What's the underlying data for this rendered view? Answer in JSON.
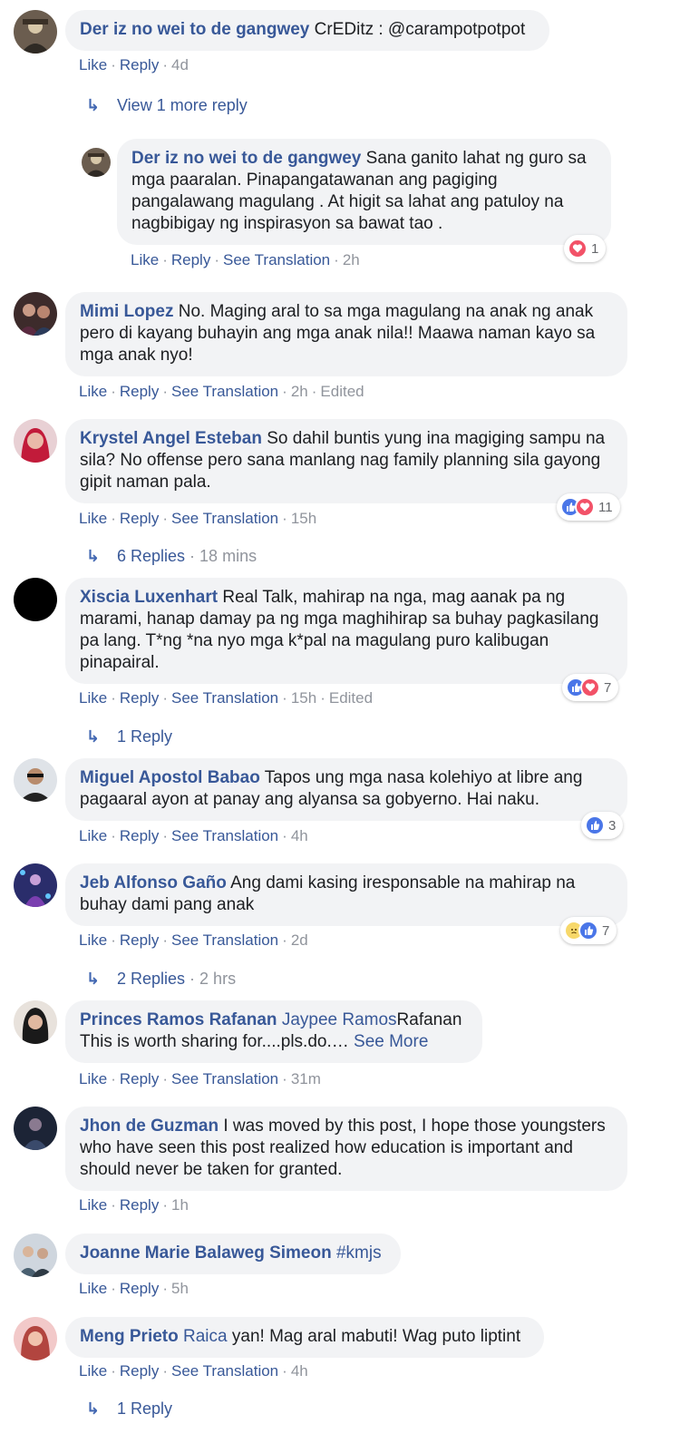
{
  "colors": {
    "link": "#385898",
    "meta": "#90949c",
    "bubble": "#f2f3f5",
    "like": "#4a76e8",
    "love": "#f25268",
    "sad": "#f7d86a"
  },
  "comments": [
    {
      "author": "Der iz no wei to de gangwey",
      "text": "CrEDitz : @carampotpotpot",
      "actions": [
        "Like",
        "Reply"
      ],
      "time": "4d"
    },
    {
      "view_more": "View 1 more reply"
    },
    {
      "author": "Der iz no wei to de gangwey",
      "text": "Sana ganito lahat ng guro sa mga paaralan. Pinapangatawanan ang pagiging pangalawang magulang . At higit sa lahat ang patuloy na nagbibigay ng inspirasyon sa bawat tao .",
      "actions": [
        "Like",
        "Reply",
        "See Translation"
      ],
      "time": "2h",
      "reaction_count": "1"
    },
    {
      "author": "Mimi Lopez",
      "text": "No. Maging aral to sa mga magulang na anak ng anak pero di kayang buhayin ang mga anak nila!! Maawa naman kayo sa mga anak nyo!",
      "actions": [
        "Like",
        "Reply",
        "See Translation"
      ],
      "time": "2h",
      "edited": "Edited"
    },
    {
      "author": "Krystel Angel Esteban",
      "text": "So dahil buntis yung ina magiging sampu na sila? No offense pero sana manlang nag family planning sila gayong gipit naman pala.",
      "actions": [
        "Like",
        "Reply",
        "See Translation"
      ],
      "time": "15h",
      "reaction_count": "11",
      "replies": "6 Replies",
      "replies_time": "18 mins"
    },
    {
      "author": "Xiscia Luxenhart",
      "text": "Real Talk, mahirap na nga, mag aanak pa ng marami, hanap damay pa ng mga maghihirap sa buhay pagkasilang pa lang. T*ng *na nyo mga k*pal na magulang puro kalibugan pinapairal.",
      "actions": [
        "Like",
        "Reply",
        "See Translation"
      ],
      "time": "15h",
      "edited": "Edited",
      "reaction_count": "7",
      "replies": "1 Reply"
    },
    {
      "author": "Miguel Apostol Babao",
      "text": "Tapos ung mga nasa kolehiyo at libre ang pagaaral ayon at panay ang alyansa sa gobyerno. Hai naku.",
      "actions": [
        "Like",
        "Reply",
        "See Translation"
      ],
      "time": "4h",
      "reaction_count": "3"
    },
    {
      "author": "Jeb Alfonso Gaño",
      "text": "Ang dami kasing iresponsable na mahirap na buhay dami pang anak",
      "actions": [
        "Like",
        "Reply",
        "See Translation"
      ],
      "time": "2d",
      "reaction_count": "7",
      "replies": "2 Replies",
      "replies_time": "2 hrs"
    },
    {
      "author": "Princes Ramos Rafanan",
      "mention": "Jaypee Ramos",
      "mention_tail": "Rafanan",
      "text": "This is worth sharing for....pls.do.…",
      "see_more": "See More",
      "actions": [
        "Like",
        "Reply",
        "See Translation"
      ],
      "time": "31m"
    },
    {
      "author": "Jhon de Guzman",
      "text": "I was moved by this post, I hope those youngsters who have seen this post realized how education is important and should never be taken for granted.",
      "actions": [
        "Like",
        "Reply"
      ],
      "time": "1h"
    },
    {
      "author": "Joanne Marie Balaweg Simeon",
      "hashtag": "#kmjs",
      "actions": [
        "Like",
        "Reply"
      ],
      "time": "5h"
    },
    {
      "author": "Meng Prieto",
      "mention": "Raica",
      "text": "yan! Mag aral mabuti! Wag puto liptint",
      "actions": [
        "Like",
        "Reply",
        "See Translation"
      ],
      "time": "4h",
      "replies": "1 Reply"
    }
  ]
}
